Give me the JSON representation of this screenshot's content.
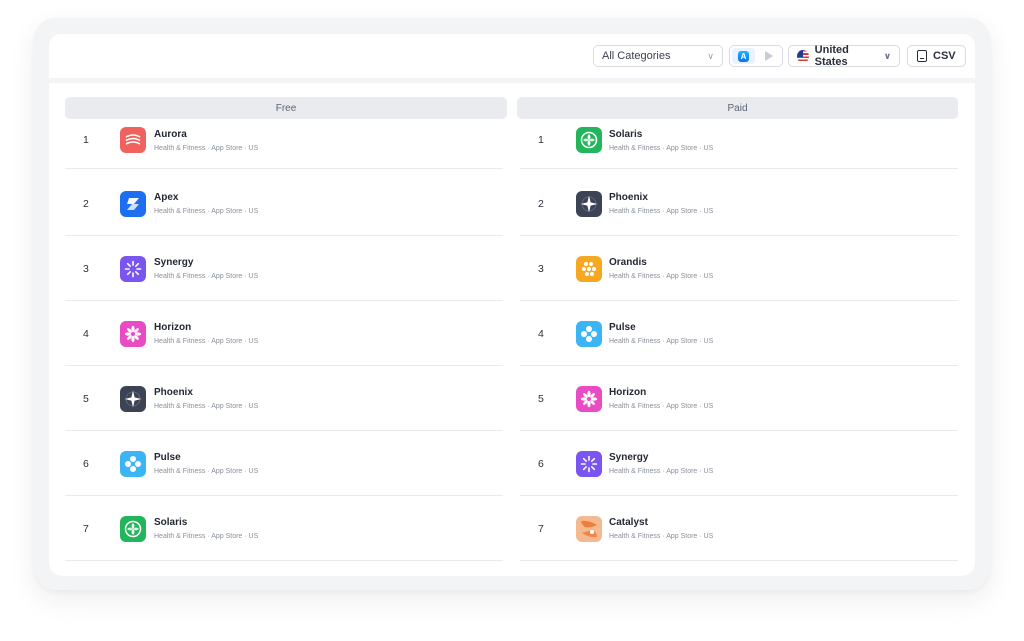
{
  "toolbar": {
    "category_select": "All Categories",
    "country": "United States",
    "csv_label": "CSV"
  },
  "columns": {
    "free": "Free",
    "paid": "Paid"
  },
  "free": [
    {
      "rank": "1",
      "name": "Aurora",
      "sub": "Health & Fitness · App Store · US",
      "icon": "aurora-wave-icon",
      "color": "#f0625e"
    },
    {
      "rank": "2",
      "name": "Apex",
      "sub": "Health & Fitness · App Store · US",
      "icon": "apex-chevron-icon",
      "color": "#1e6ef2"
    },
    {
      "rank": "3",
      "name": "Synergy",
      "sub": "Health & Fitness · App Store · US",
      "icon": "synergy-burst-icon",
      "color": "#7a55f0"
    },
    {
      "rank": "4",
      "name": "Horizon",
      "sub": "Health & Fitness · App Store · US",
      "icon": "horizon-flower-icon",
      "color": "#e94bc4"
    },
    {
      "rank": "5",
      "name": "Phoenix",
      "sub": "Health & Fitness · App Store · US",
      "icon": "phoenix-star-icon",
      "color": "#3c4354"
    },
    {
      "rank": "6",
      "name": "Pulse",
      "sub": "Health & Fitness · App Store · US",
      "icon": "pulse-dots-icon",
      "color": "#3bb5f5"
    },
    {
      "rank": "7",
      "name": "Solaris",
      "sub": "Health & Fitness · App Store · US",
      "icon": "solaris-leaf-icon",
      "color": "#22b55c"
    }
  ],
  "paid": [
    {
      "rank": "1",
      "name": "Solaris",
      "sub": "Health & Fitness · App Store · US",
      "icon": "solaris-leaf-icon",
      "color": "#22b55c"
    },
    {
      "rank": "2",
      "name": "Phoenix",
      "sub": "Health & Fitness · App Store · US",
      "icon": "phoenix-star-icon",
      "color": "#3c4354"
    },
    {
      "rank": "3",
      "name": "Orandis",
      "sub": "Health & Fitness · App Store · US",
      "icon": "orandis-grid-icon",
      "color": "#f7a823"
    },
    {
      "rank": "4",
      "name": "Pulse",
      "sub": "Health & Fitness · App Store · US",
      "icon": "pulse-dots-icon",
      "color": "#3bb5f5"
    },
    {
      "rank": "5",
      "name": "Horizon",
      "sub": "Health & Fitness · App Store · US",
      "icon": "horizon-flower-icon",
      "color": "#e94bc4"
    },
    {
      "rank": "6",
      "name": "Synergy",
      "sub": "Health & Fitness · App Store · US",
      "icon": "synergy-burst-icon",
      "color": "#7a55f0"
    },
    {
      "rank": "7",
      "name": "Catalyst",
      "sub": "Health & Fitness · App Store · US",
      "icon": "catalyst-blob-icon",
      "color": "#f5b98f"
    }
  ]
}
